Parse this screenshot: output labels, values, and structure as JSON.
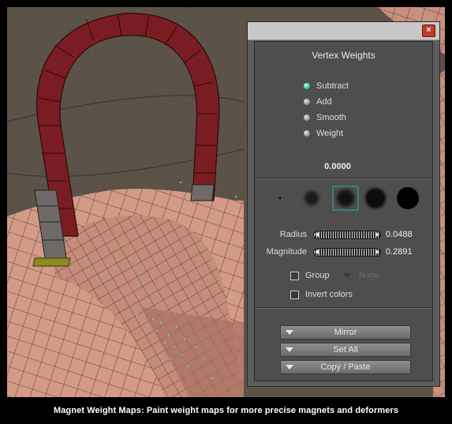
{
  "panel": {
    "title": "Vertex Weights",
    "close_glyph": "×",
    "modes": [
      {
        "label": "Subtract",
        "selected": true
      },
      {
        "label": "Add",
        "selected": false
      },
      {
        "label": "Smooth",
        "selected": false
      },
      {
        "label": "Weight",
        "selected": false
      }
    ],
    "weight_value": "0.0000",
    "brushes": [
      "brush-tiny",
      "brush-small-soft",
      "brush-medium-soft",
      "brush-large-soft",
      "brush-large-hard"
    ],
    "selected_brush_index": 2,
    "radius": {
      "label": "Radius",
      "value": "0.0488"
    },
    "magnitude": {
      "label": "Magnitude",
      "value": "0.2891"
    },
    "group": {
      "label": "Group",
      "dropdown_value": "None",
      "checked": false
    },
    "invert": {
      "label": "Invert colors",
      "checked": false
    },
    "buttons": {
      "mirror": "Mirror",
      "set_all": "Set All",
      "copy_paste": "Copy / Paste"
    },
    "accent_color": "#2bb9a3"
  },
  "caption": "Magnet Weight Maps: Paint weight maps for more precise magnets and deformers"
}
